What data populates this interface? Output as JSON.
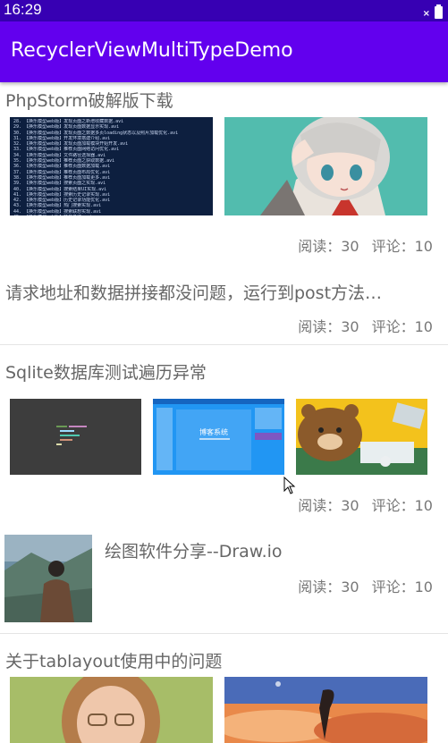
{
  "status_bar": {
    "time": "16:29"
  },
  "app_bar": {
    "title": "RecyclerViewMultiTypeDemo"
  },
  "items": [
    {
      "title": "PhpStorm破解版下载",
      "reads": "阅读：30",
      "comments": "评论：10"
    },
    {
      "title": "请求地址和数据拼接都没问题，运行到post方法…",
      "reads": "阅读：30",
      "comments": "评论：10"
    },
    {
      "title": "Sqlite数据库测试遍历异常",
      "reads": "阅读：30",
      "comments": "评论：10"
    },
    {
      "title": "绘图软件分享--Draw.io",
      "reads": "阅读：30",
      "comments": "评论：10"
    },
    {
      "title": "关于tablayout使用中的问题"
    }
  ],
  "code_lines": [
    "28. 【换乐模型web版】发现页面之新增收藏数据.avi",
    "29. 【换乐模型web版】发现页面数据显示实现.avi",
    "30. 【换乐模型web版】发现页面之数据多页loading状态以及照片加载优化.avi",
    "31. 【换乐模型web版】开发环境搭建介绍.avi",
    "32. 【换乐模型web版】发现页面加载模块开始开发.avi",
    "33. 【换乐模型web版】推荐页面网络访问优化.avi",
    "34. 【换乐模型web版】文件路径选择器.avi",
    "35. 【换乐模型web版】推荐页面之获取数据.avi",
    "36. 【换乐模型web版】推荐页面数据加载.avi",
    "37. 【换乐模型web版】推荐页面布局优化.avi",
    "38. 【换乐模型web版】推荐页面加载更多.avi",
    "39. 【换乐模型web版】搜索页面之实现.avi",
    "40. 【换乐模型web版】搜索结果UI实现.avi",
    "41. 【换乐模型web版】搜索历史记录实现.avi",
    "42. 【换乐模型web版】历史记录功能优化.avi",
    "43. 【换乐模型web版】热门搜索实现.avi",
    "44. 【换乐模型web版】搜索联想实现.avi",
    "45. 【换乐模型web版】项目总结.avi"
  ],
  "blog_thumb": {
    "heading": "博客系统"
  }
}
